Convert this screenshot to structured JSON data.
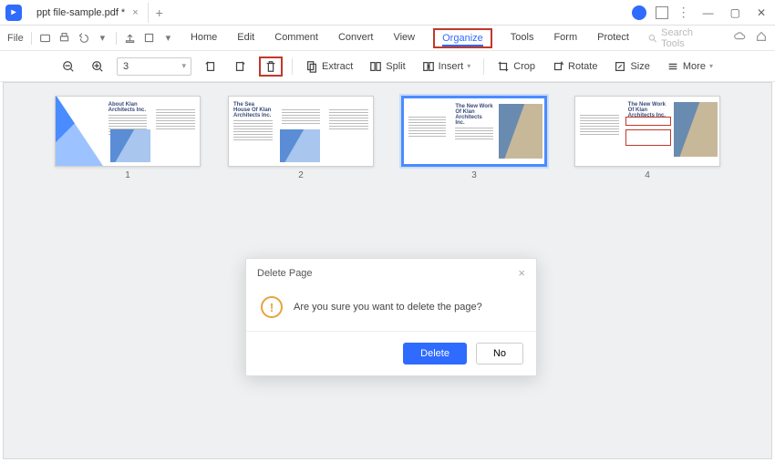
{
  "window": {
    "tab_title": "ppt file-sample.pdf *"
  },
  "menubar": {
    "file": "File",
    "tabs": [
      "Home",
      "Edit",
      "Comment",
      "Convert",
      "View",
      "Organize",
      "Tools",
      "Form",
      "Protect"
    ],
    "active_tab_index": 5,
    "search_placeholder": "Search Tools"
  },
  "toolbar": {
    "page_input": "3",
    "extract": "Extract",
    "split": "Split",
    "insert": "Insert",
    "crop": "Crop",
    "rotate": "Rotate",
    "size": "Size",
    "more": "More"
  },
  "thumbnails": [
    {
      "num": "1",
      "title": "About Klan Architects Inc."
    },
    {
      "num": "2",
      "title": "The Sea House Of Klan Architects Inc."
    },
    {
      "num": "3",
      "title": "The New Work Of Klan Architects Inc."
    },
    {
      "num": "4",
      "title": "The New Work Of Klan Architects Inc."
    }
  ],
  "selected_thumb": 2,
  "dialog": {
    "title": "Delete Page",
    "message": "Are you sure you want to delete the page?",
    "confirm": "Delete",
    "cancel": "No"
  }
}
